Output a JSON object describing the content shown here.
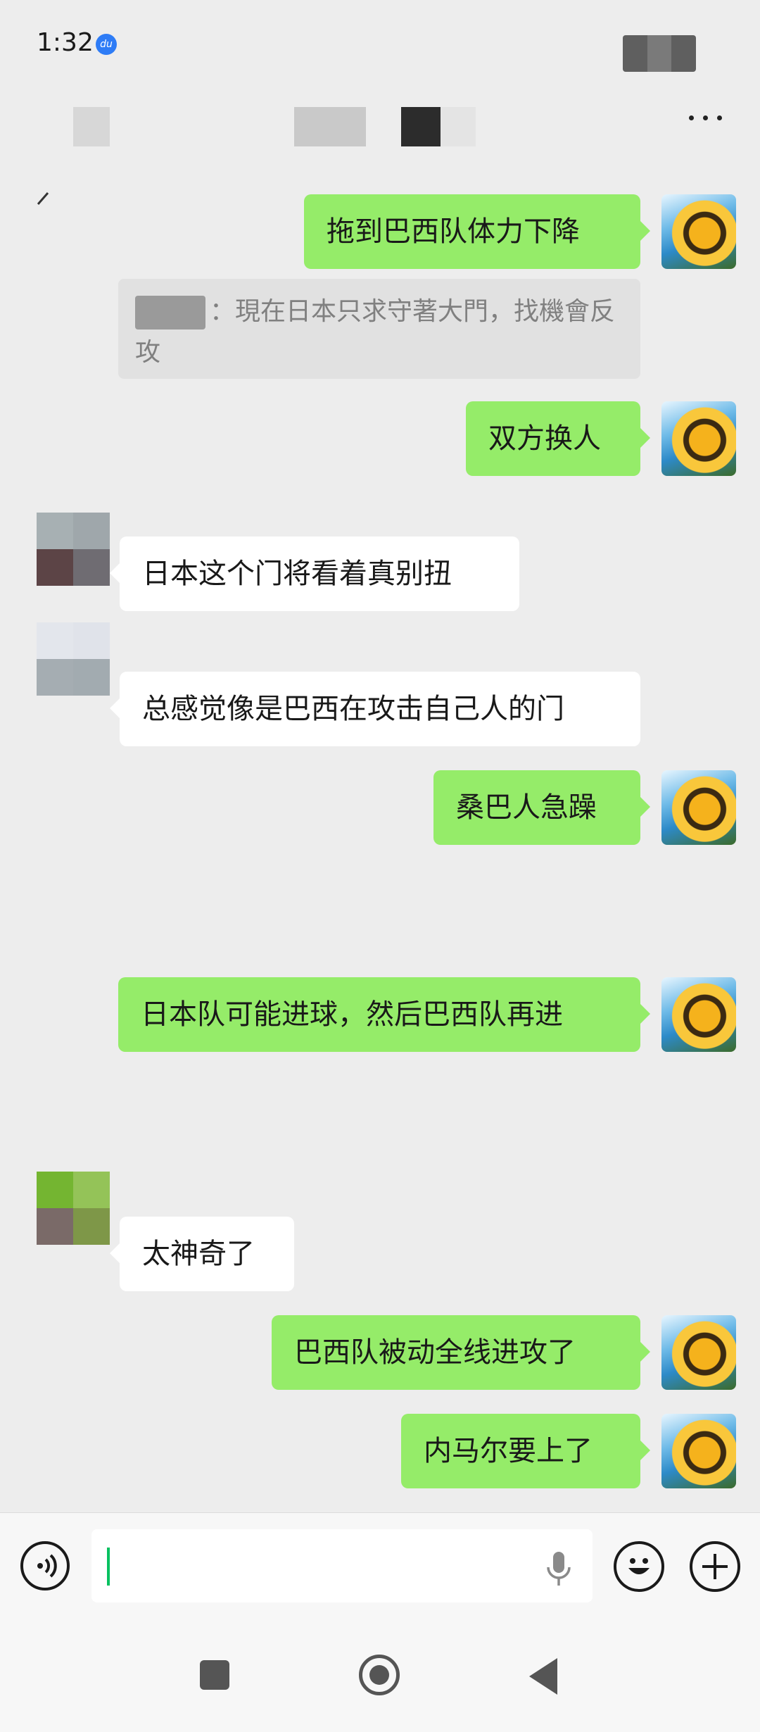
{
  "status_bar": {
    "time": "1:32",
    "app_badge": "du"
  },
  "chat": {
    "quote": {
      "text": "：現在日本只求守著大門，找機會反攻"
    },
    "messages": [
      {
        "side": "self",
        "text": "拖到巴西队体力下降"
      },
      {
        "side": "self",
        "text": "双方换人"
      },
      {
        "side": "other",
        "text": "日本这个门将看着真别扭"
      },
      {
        "side": "other",
        "text": "总感觉像是巴西在攻击自己人的门"
      },
      {
        "side": "self",
        "text": "桑巴人急躁"
      },
      {
        "side": "self",
        "text": "日本队可能进球，然后巴西队再进"
      },
      {
        "side": "other",
        "text": "太神奇了"
      },
      {
        "side": "self",
        "text": "巴西队被动全线进攻了"
      },
      {
        "side": "self",
        "text": "内马尔要上了"
      }
    ]
  },
  "input_bar": {
    "value": ""
  },
  "icons": {
    "voice": "voice-icon",
    "mic": "mic-icon",
    "emoji": "emoji-icon",
    "plus": "plus-icon",
    "more": "more-icon",
    "back": "back-icon"
  },
  "colors": {
    "self_bubble": "#95ec69",
    "other_bubble": "#ffffff",
    "background": "#ededed",
    "caret": "#07c160"
  }
}
